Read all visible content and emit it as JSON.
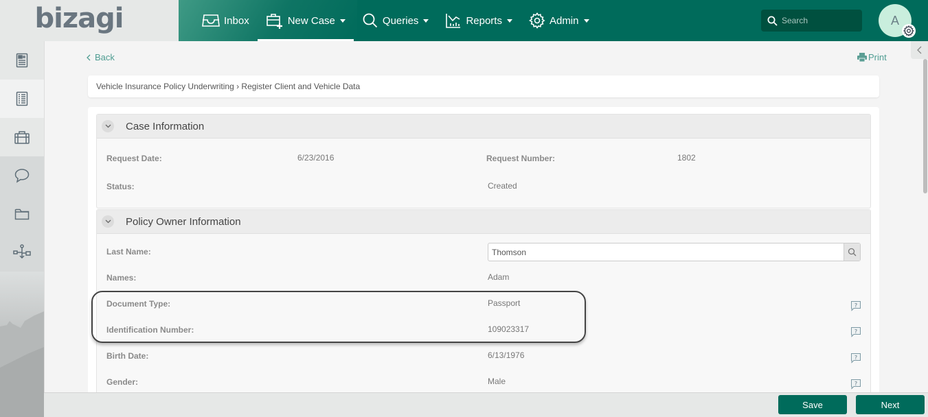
{
  "app": {
    "logo": "bizagi"
  },
  "nav": {
    "items": [
      {
        "label": "Inbox",
        "icon": "inbox-icon",
        "dropdown": false
      },
      {
        "label": "New Case",
        "icon": "new-case-icon",
        "dropdown": true,
        "active": true
      },
      {
        "label": "Queries",
        "icon": "search-icon",
        "dropdown": true
      },
      {
        "label": "Reports",
        "icon": "chart-icon",
        "dropdown": true
      },
      {
        "label": "Admin",
        "icon": "gear-icon",
        "dropdown": true
      }
    ],
    "search_placeholder": "Search",
    "avatar_initial": "A"
  },
  "sidebar": {
    "items": [
      {
        "icon": "case-summary-icon"
      },
      {
        "icon": "activities-list-icon"
      },
      {
        "icon": "briefcase-icon"
      },
      {
        "icon": "comments-icon"
      },
      {
        "icon": "folder-icon"
      },
      {
        "icon": "process-flow-icon"
      }
    ]
  },
  "page": {
    "back_label": "Back",
    "print_label": "Print",
    "breadcrumb": "Vehicle Insurance Policy Underwriting › Register Client and Vehicle Data"
  },
  "case_info": {
    "title": "Case Information",
    "request_date_label": "Request Date:",
    "request_date": "6/23/2016",
    "request_number_label": "Request Number:",
    "request_number": "1802",
    "status_label": "Status:",
    "status": "Created"
  },
  "policy_owner": {
    "title": "Policy Owner Information",
    "last_name_label": "Last Name:",
    "last_name": "Thomson",
    "names_label": "Names:",
    "names": "Adam",
    "document_type_label": "Document Type:",
    "document_type": "Passport",
    "id_number_label": "Identification Number:",
    "id_number": "109023317",
    "birth_date_label": "Birth Date:",
    "birth_date": "6/13/1976",
    "gender_label": "Gender:",
    "gender": "Male"
  },
  "footer": {
    "save_label": "Save",
    "next_label": "Next"
  },
  "colors": {
    "brand": "#006b5b",
    "link": "#4f9d92"
  }
}
